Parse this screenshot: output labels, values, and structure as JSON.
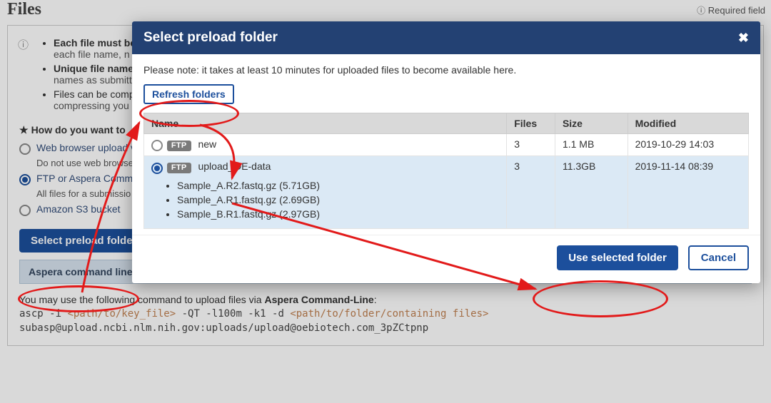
{
  "page": {
    "title": "Files",
    "required_field_label": "Required field"
  },
  "tips": {
    "line1_bold": "Each file must be",
    "line1_rest": "each file name, n",
    "line2_bold": "Unique file name",
    "line2_rest": "names as submitt",
    "line3a": "Files can be comp",
    "line3b": "compressing you"
  },
  "upload": {
    "question": "How do you want to",
    "opt1_label": "Web browser upload vi",
    "opt1_hint": "Do not use web browse",
    "opt2_label": "FTP or Aspera Comma",
    "opt2_hint": "All files for a submissio",
    "opt3_label": "Amazon S3 bucket",
    "selected": 2
  },
  "preload_button": "Select preload folder",
  "accordion_label": "Aspera command line upload instructions",
  "cmd": {
    "intro_pre": "You may use the following command to upload files via ",
    "intro_bold": "Aspera Command-Line",
    "line_prefix": "ascp -i ",
    "path1": "<path/to/key_file>",
    "mid": " -QT -l100m -k1 -d ",
    "path2": "<path/to/folder/containing files>",
    "line2": "subasp@upload.ncbi.nlm.nih.gov:uploads/upload@oebiotech.com_3pZCtpnp"
  },
  "modal": {
    "title": "Select preload folder",
    "note": "Please note: it takes at least 10 minutes for uploaded files to become available here.",
    "refresh_label": "Refresh folders",
    "headers": {
      "name": "Name",
      "files": "Files",
      "size": "Size",
      "modified": "Modified"
    },
    "rows": [
      {
        "badge": "FTP",
        "name": "new",
        "files": "3",
        "size": "1.1 MB",
        "modified": "2019-10-29 14:03",
        "selected": false
      },
      {
        "badge": "FTP",
        "name": "upload_OE-data",
        "files": "3",
        "size": "11.3GB",
        "modified": "2019-11-14 08:39",
        "selected": true,
        "children": [
          "Sample_A.R2.fastq.gz (5.71GB)",
          "Sample_A.R1.fastq.gz (2.69GB)",
          "Sample_B.R1.fastq.gz (2.97GB)"
        ]
      }
    ],
    "use_label": "Use selected folder",
    "cancel_label": "Cancel"
  }
}
